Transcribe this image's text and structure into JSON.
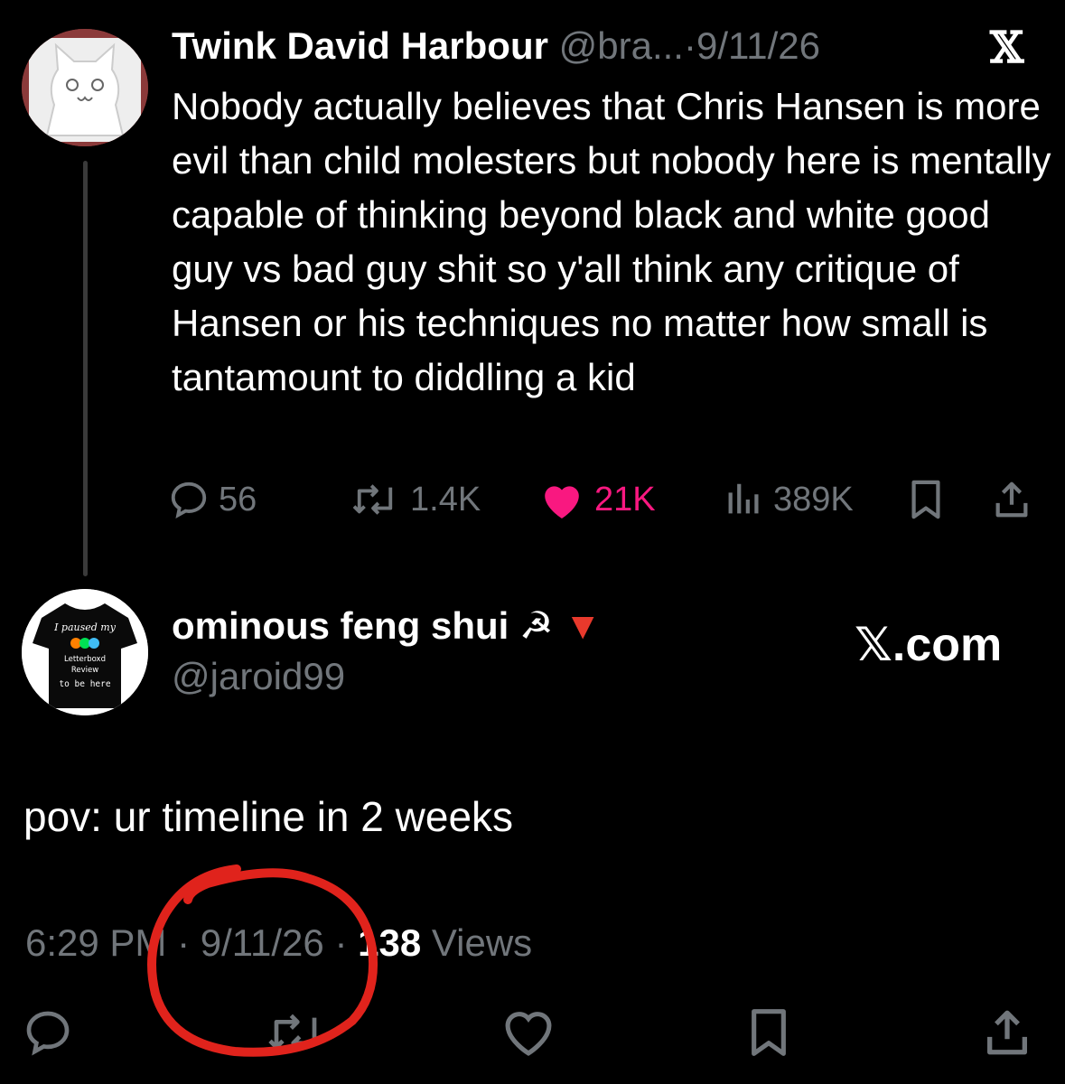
{
  "quoted_tweet": {
    "author_name": "Twink David Harbour",
    "handle": "@bra...",
    "separator": "·",
    "date": "9/11/26",
    "platform_logo": "𝕏",
    "text": "Nobody actually believes that Chris Hansen is more evil than child molesters but nobody here is mentally capable of thinking beyond black and white good guy vs bad guy shit so y'all think any critique of Hansen or his techniques no matter how small is tantamount to diddling a kid",
    "actions": {
      "replies": "56",
      "reposts": "1.4K",
      "likes": "21K",
      "views": "389K"
    },
    "like_color": "#f91880"
  },
  "main_tweet": {
    "author_name": "ominous feng shui ☭",
    "author_badge": "▼",
    "handle": "@jaroid99",
    "watermark": "𝕏.com",
    "avatar_text": {
      "line1": "I paused my",
      "line2": "Letterboxd",
      "line3": "Review",
      "line4": "to be here"
    },
    "text": "pov: ur timeline in 2 weeks",
    "time": "6:29 PM",
    "date": "9/11/26",
    "views_count": "138",
    "views_label": "Views",
    "separator": "·"
  },
  "annotation_color": "#e0231c"
}
